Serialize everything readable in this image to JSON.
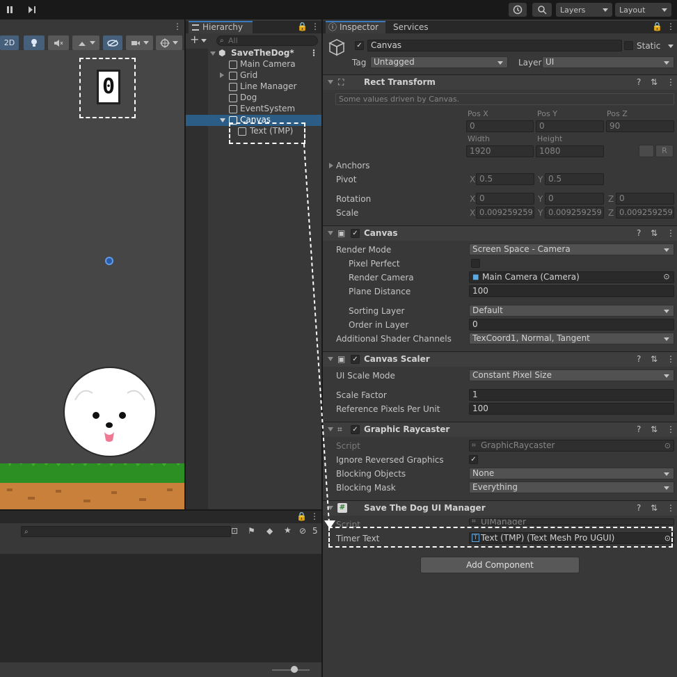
{
  "toolbar": {
    "pause_icon": "pause-icon",
    "step_icon": "step-icon",
    "layers_label": "Layers",
    "layout_label": "Layout"
  },
  "scene": {
    "mode_2d": "2D",
    "timer_display": "0"
  },
  "hierarchy": {
    "tab_label": "Hierarchy",
    "search_placeholder": "All",
    "root": "SaveTheDog*",
    "items": [
      "Main Camera",
      "Grid",
      "Line Manager",
      "Dog",
      "EventSystem",
      "Canvas",
      "Text (TMP)"
    ],
    "selected": "Canvas"
  },
  "project": {
    "hidden_count": "5"
  },
  "inspector": {
    "tabs": [
      "Inspector",
      "Services"
    ],
    "object_name": "Canvas",
    "static_label": "Static",
    "tag_label": "Tag",
    "tag_value": "Untagged",
    "layer_label": "Layer",
    "layer_value": "UI",
    "rect_transform": {
      "title": "Rect Transform",
      "note": "Some values driven by Canvas.",
      "pos_x_label": "Pos X",
      "pos_x": "0",
      "pos_y_label": "Pos Y",
      "pos_y": "0",
      "pos_z_label": "Pos Z",
      "pos_z": "90",
      "width_label": "Width",
      "width": "1920",
      "height_label": "Height",
      "height": "1080",
      "anchors_label": "Anchors",
      "pivot_label": "Pivot",
      "pivot_x": "0.5",
      "pivot_y": "0.5",
      "rotation_label": "Rotation",
      "rot_x": "0",
      "rot_y": "0",
      "rot_z": "0",
      "scale_label": "Scale",
      "scale_x": "0.009259259",
      "scale_y": "0.009259259",
      "scale_z": "0.009259259",
      "axis_x": "X",
      "axis_y": "Y",
      "axis_z": "Z",
      "r_button": "R"
    },
    "canvas": {
      "title": "Canvas",
      "render_mode_label": "Render Mode",
      "render_mode": "Screen Space - Camera",
      "pixel_perfect_label": "Pixel Perfect",
      "render_camera_label": "Render Camera",
      "render_camera": "Main Camera (Camera)",
      "plane_distance_label": "Plane Distance",
      "plane_distance": "100",
      "sorting_layer_label": "Sorting Layer",
      "sorting_layer": "Default",
      "order_in_layer_label": "Order in Layer",
      "order_in_layer": "0",
      "shader_channels_label": "Additional Shader Channels",
      "shader_channels": "TexCoord1, Normal, Tangent"
    },
    "canvas_scaler": {
      "title": "Canvas Scaler",
      "ui_scale_mode_label": "UI Scale Mode",
      "ui_scale_mode": "Constant Pixel Size",
      "scale_factor_label": "Scale Factor",
      "scale_factor": "1",
      "ref_ppu_label": "Reference Pixels Per Unit",
      "ref_ppu": "100"
    },
    "graphic_raycaster": {
      "title": "Graphic Raycaster",
      "script_label": "Script",
      "script": "GraphicRaycaster",
      "ignore_reversed_label": "Ignore Reversed Graphics",
      "blocking_objects_label": "Blocking Objects",
      "blocking_objects": "None",
      "blocking_mask_label": "Blocking Mask",
      "blocking_mask": "Everything"
    },
    "ui_manager": {
      "title": "Save The Dog UI Manager",
      "script_label": "Script",
      "script": "UIManager",
      "timer_text_label": "Timer Text",
      "timer_text": "Text (TMP) (Text Mesh Pro UGUI)"
    },
    "add_component": "Add Component"
  }
}
